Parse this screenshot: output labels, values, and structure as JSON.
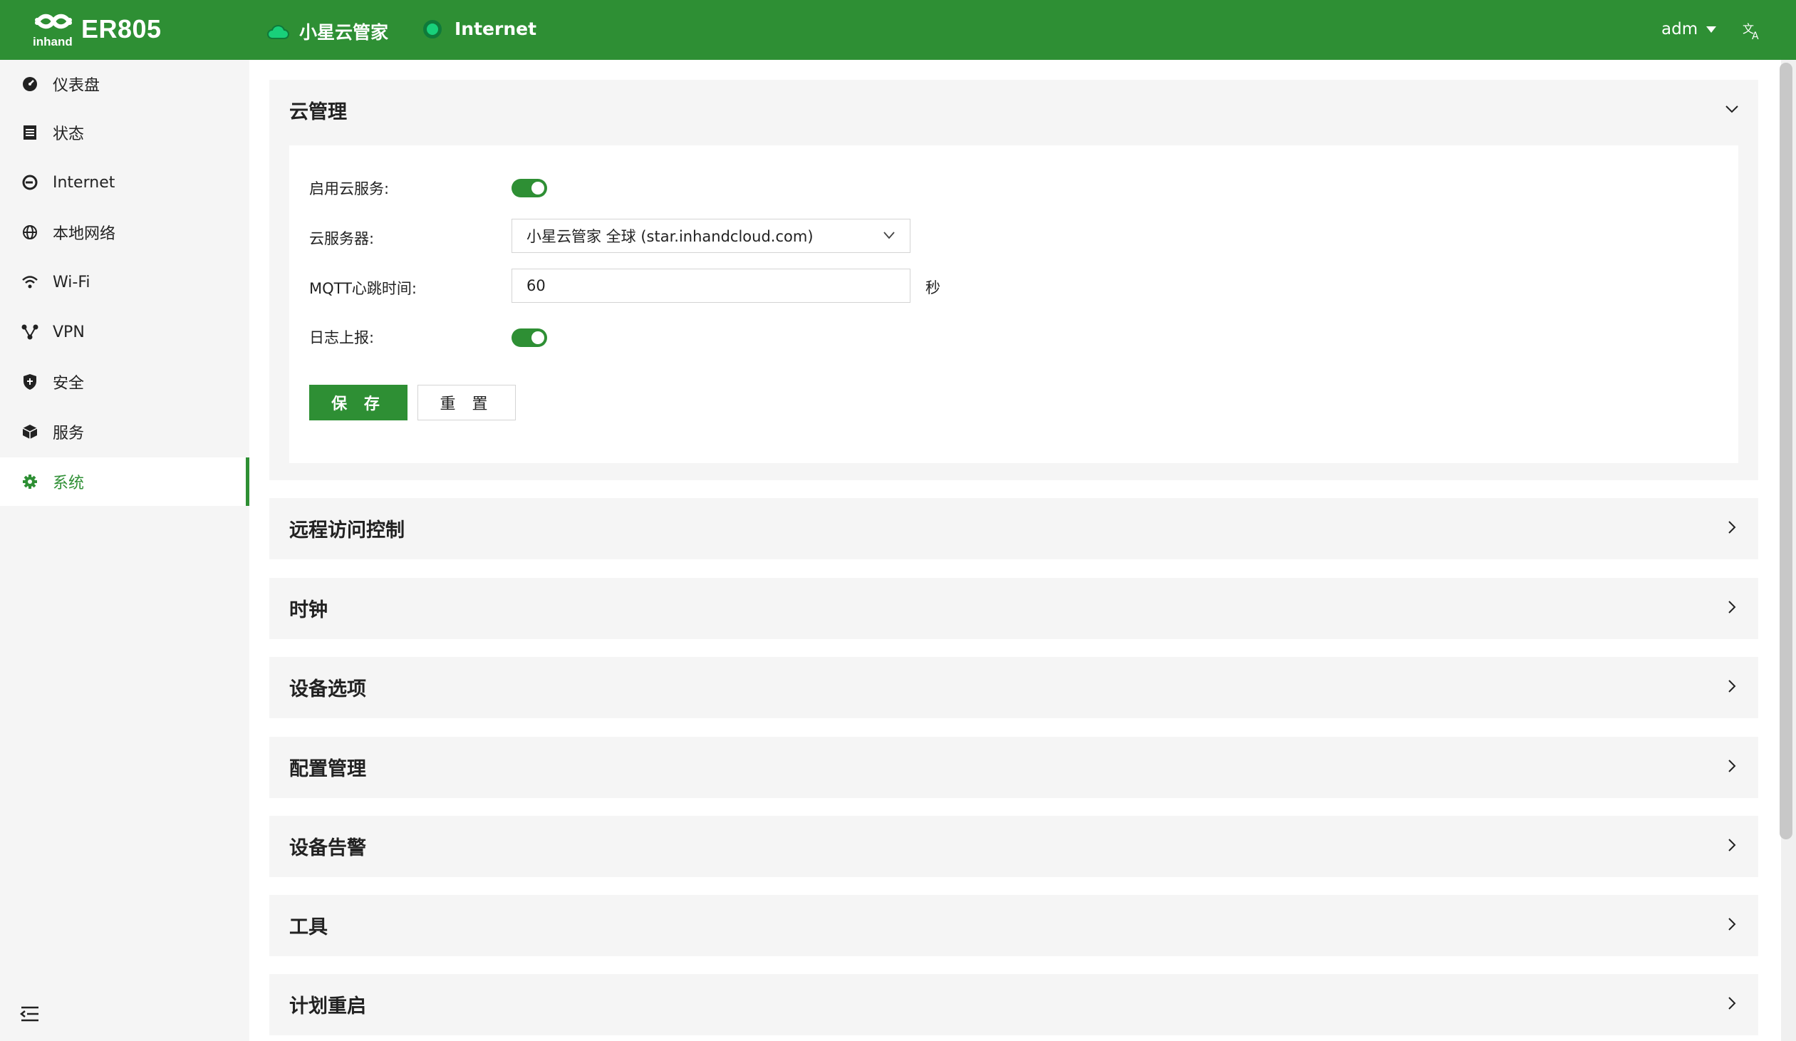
{
  "header": {
    "brand_text": "inhand",
    "model": "ER805",
    "cloud_status": "小星云管家",
    "internet_status": "Internet",
    "user": "adm",
    "colors": {
      "brand_green": "#2e8f34",
      "online_dot": "#18d07a"
    }
  },
  "sidebar": {
    "items": [
      {
        "label": "仪表盘",
        "icon": "dashboard-icon"
      },
      {
        "label": "状态",
        "icon": "status-list-icon"
      },
      {
        "label": "Internet",
        "icon": "internet-icon"
      },
      {
        "label": "本地网络",
        "icon": "globe-icon"
      },
      {
        "label": "Wi-Fi",
        "icon": "wifi-icon"
      },
      {
        "label": "VPN",
        "icon": "vpn-icon"
      },
      {
        "label": "安全",
        "icon": "shield-icon"
      },
      {
        "label": "服务",
        "icon": "box-icon"
      },
      {
        "label": "系统",
        "icon": "gear-icon",
        "active": true
      }
    ]
  },
  "cloud_panel": {
    "title": "云管理",
    "enable_label": "启用云服务:",
    "enable_on": true,
    "server_label": "云服务器:",
    "server_value": "小星云管家 全球 (star.inhandcloud.com)",
    "mqtt_label": "MQTT心跳时间:",
    "mqtt_value": "60",
    "mqtt_unit": "秒",
    "log_label": "日志上报:",
    "log_on": true,
    "save_label": "保 存",
    "reset_label": "重 置"
  },
  "panels": [
    {
      "title": "远程访问控制"
    },
    {
      "title": "时钟"
    },
    {
      "title": "设备选项"
    },
    {
      "title": "配置管理"
    },
    {
      "title": "设备告警"
    },
    {
      "title": "工具"
    },
    {
      "title": "计划重启"
    }
  ]
}
